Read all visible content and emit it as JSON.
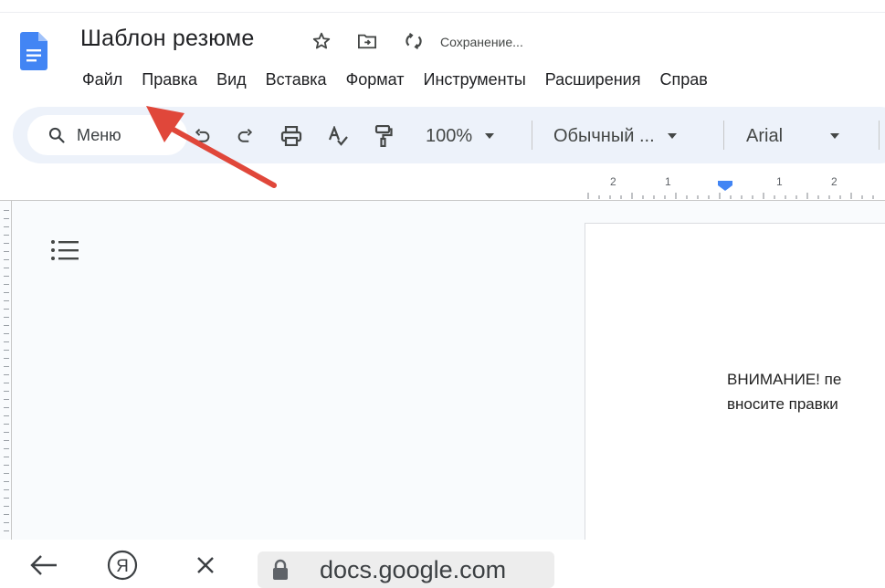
{
  "document": {
    "title": "Шаблон резюме",
    "saving_status": "Сохранение..."
  },
  "menu": {
    "items": [
      {
        "label": "Файл"
      },
      {
        "label": "Правка"
      },
      {
        "label": "Вид"
      },
      {
        "label": "Вставка"
      },
      {
        "label": "Формат"
      },
      {
        "label": "Инструменты"
      },
      {
        "label": "Расширения"
      },
      {
        "label": "Справ"
      }
    ]
  },
  "toolbar": {
    "search_label": "Меню",
    "zoom": "100%",
    "style": "Обычный ...",
    "font": "Arial"
  },
  "ruler": {
    "labels": [
      "2",
      "1",
      "1",
      "2"
    ]
  },
  "page": {
    "line1": "ВНИМАНИЕ! пе",
    "line2": "вносите правки"
  },
  "browser": {
    "url": "docs.google.com",
    "yandex_letter": "Я"
  },
  "colors": {
    "docs_blue": "#4285f4",
    "toolbar_bg": "#edf2fa",
    "annotation_arrow": "#e0473a"
  }
}
